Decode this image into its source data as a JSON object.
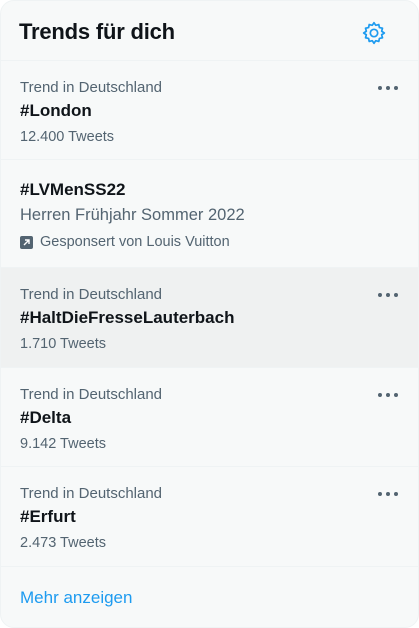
{
  "header": {
    "title": "Trends für dich",
    "settings_icon": "gear-icon"
  },
  "colors": {
    "accent": "#1d9bf0",
    "text": "#0f1419",
    "muted": "#536471",
    "background": "#f7f9f9"
  },
  "trends": [
    {
      "context": "Trend in Deutschland",
      "name": "#London",
      "count": "12.400 Tweets"
    },
    {
      "name": "#LVMenSS22",
      "description": "Herren Frühjahr Sommer 2022",
      "promoted": "Gesponsert von Louis Vuitton"
    },
    {
      "context": "Trend in Deutschland",
      "name": "#HaltDieFresseLauterbach",
      "count": "1.710 Tweets"
    },
    {
      "context": "Trend in Deutschland",
      "name": "#Delta",
      "count": "9.142 Tweets"
    },
    {
      "context": "Trend in Deutschland",
      "name": "#Erfurt",
      "count": "2.473 Tweets"
    }
  ],
  "footer": {
    "show_more": "Mehr anzeigen"
  }
}
